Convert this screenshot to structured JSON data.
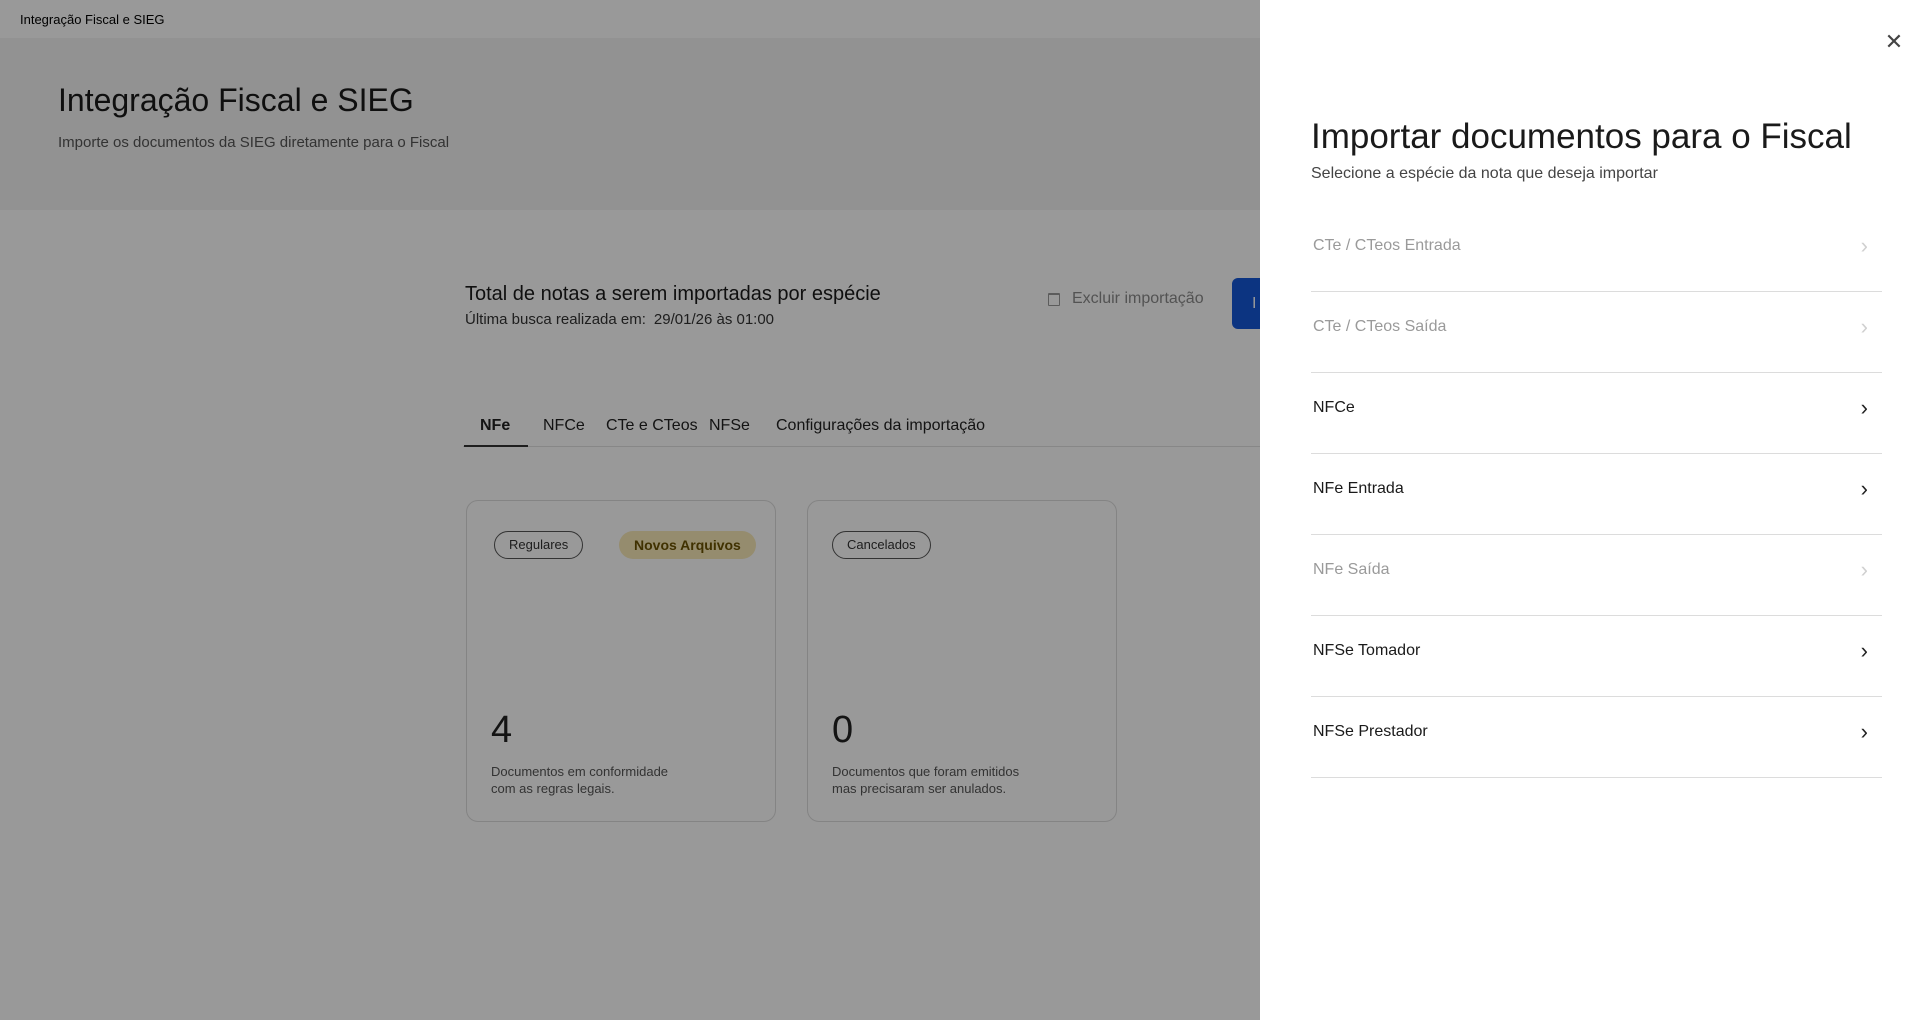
{
  "window": {
    "title": "Integração Fiscal e SIEG"
  },
  "hero": {
    "title": "Integração Fiscal e SIEG",
    "subtitle": "Importe os documentos da SIEG diretamente para o Fiscal"
  },
  "summary": {
    "title": "Total de notas a serem importadas por espécie",
    "last_search_label": "Última busca realizada em:",
    "last_search_value": "29/01/26 às 01:00",
    "exclude_label": "Excluir importação",
    "import_button_label": "I"
  },
  "tabs": [
    {
      "label": "NFe",
      "active": true
    },
    {
      "label": "NFCe",
      "active": false
    },
    {
      "label": "CTe e CTeos",
      "active": false
    },
    {
      "label": "NFSe",
      "active": false
    },
    {
      "label": "Configurações da importação",
      "active": false
    }
  ],
  "cards": [
    {
      "pill": "Regulares",
      "badge": "Novos Arquivos",
      "count": "4",
      "description": "Documentos em conformidade com as regras legais."
    },
    {
      "pill": "Cancelados",
      "count": "0",
      "description": "Documentos que foram emitidos mas precisaram ser anulados."
    }
  ],
  "drawer": {
    "title": "Importar documentos para o Fiscal",
    "subtitle": "Selecione a espécie da nota que deseja importar",
    "options": [
      {
        "label": "CTe / CTeos Entrada",
        "enabled": false
      },
      {
        "label": "CTe / CTeos Saída",
        "enabled": false
      },
      {
        "label": "NFCe",
        "enabled": true
      },
      {
        "label": "NFe Entrada",
        "enabled": true
      },
      {
        "label": "NFe Saída",
        "enabled": false
      },
      {
        "label": "NFSe Tomador",
        "enabled": true
      },
      {
        "label": "NFSe Prestador",
        "enabled": true
      }
    ]
  },
  "colors": {
    "primary": "#1457d8",
    "badge_bg": "#f8e9b8",
    "overlay": "rgba(0,0,0,0.40)"
  },
  "icons": {
    "close": "close-icon",
    "chevron": "chevron-right-icon",
    "trash": "trash-icon"
  }
}
